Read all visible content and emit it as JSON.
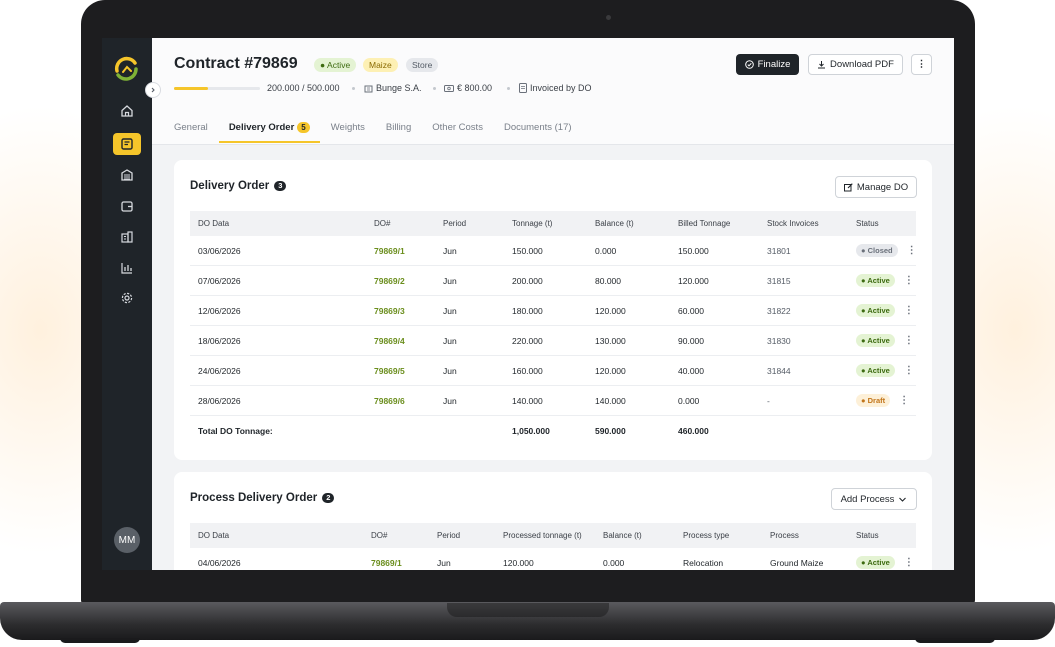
{
  "contract": {
    "title": "Contract #79869",
    "status": "Active",
    "commodity": "Maize",
    "store": "Store",
    "progress_text": "200.000 / 500.000",
    "progress_fraction": 0.4,
    "buyer": "Bunge S.A.",
    "amount": "€ 800.00",
    "invoice_note": "Invoiced by DO"
  },
  "actions": {
    "finalize": "Finalize",
    "download": "Download PDF"
  },
  "tabs": [
    {
      "label": "General"
    },
    {
      "label": "Delivery Order",
      "count": "5"
    },
    {
      "label": "Weights"
    },
    {
      "label": "Billing"
    },
    {
      "label": "Other Costs"
    },
    {
      "label": "Documents (17)"
    }
  ],
  "user": {
    "initials": "MM"
  },
  "delivery_order": {
    "title": "Delivery Order",
    "count": "3",
    "manage_label": "Manage DO",
    "columns": [
      "DO Data",
      "DO#",
      "Period",
      "Tonnage (t)",
      "Balance (t)",
      "Billed Tonnage",
      "Stock Invoices",
      "Status"
    ],
    "rows": [
      {
        "date": "03/06/2026",
        "do": "79869/1",
        "period": "Jun",
        "tonnage": "150.000",
        "balance": "0.000",
        "billed": "150.000",
        "stock": "31801",
        "status": "Closed"
      },
      {
        "date": "07/06/2026",
        "do": "79869/2",
        "period": "Jun",
        "tonnage": "200.000",
        "balance": "80.000",
        "billed": "120.000",
        "stock": "31815",
        "status": "Active"
      },
      {
        "date": "12/06/2026",
        "do": "79869/3",
        "period": "Jun",
        "tonnage": "180.000",
        "balance": "120.000",
        "billed": "60.000",
        "stock": "31822",
        "status": "Active"
      },
      {
        "date": "18/06/2026",
        "do": "79869/4",
        "period": "Jun",
        "tonnage": "220.000",
        "balance": "130.000",
        "billed": "90.000",
        "stock": "31830",
        "status": "Active"
      },
      {
        "date": "24/06/2026",
        "do": "79869/5",
        "period": "Jun",
        "tonnage": "160.000",
        "balance": "120.000",
        "billed": "40.000",
        "stock": "31844",
        "status": "Active"
      },
      {
        "date": "28/06/2026",
        "do": "79869/6",
        "period": "Jun",
        "tonnage": "140.000",
        "balance": "140.000",
        "billed": "0.000",
        "stock": "-",
        "status": "Draft"
      }
    ],
    "total": {
      "label": "Total DO Tonnage:",
      "tonnage": "1,050.000",
      "balance": "590.000",
      "billed": "460.000"
    }
  },
  "process_delivery_order": {
    "title": "Process Delivery Order",
    "count": "2",
    "add_label": "Add Process",
    "columns": [
      "DO Data",
      "DO#",
      "Period",
      "Processed tonnage (t)",
      "Balance (t)",
      "Process type",
      "Process",
      "Status"
    ],
    "rows": [
      {
        "date": "04/06/2026",
        "do": "79869/1",
        "period": "Jun",
        "processed": "120.000",
        "balance": "0.000",
        "type": "Relocation",
        "process": "Ground Maize",
        "status": "Active"
      }
    ]
  }
}
